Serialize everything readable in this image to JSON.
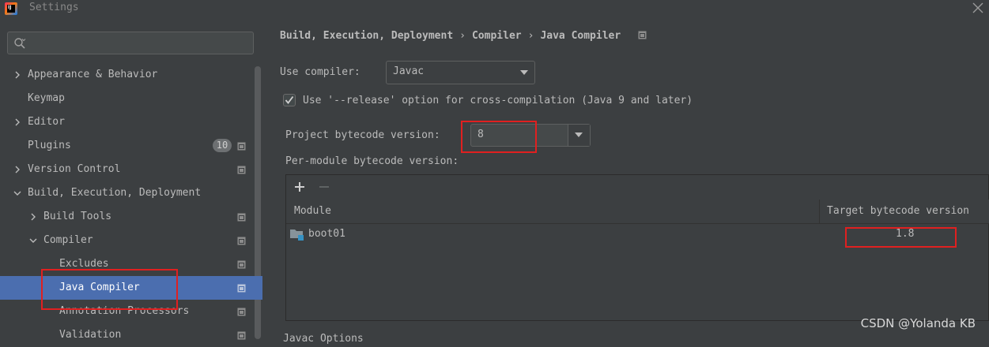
{
  "window": {
    "title": "Settings"
  },
  "search": {
    "placeholder": "",
    "value": ""
  },
  "sidebar": {
    "items": [
      {
        "label": "Appearance & Behavior"
      },
      {
        "label": "Keymap"
      },
      {
        "label": "Editor"
      },
      {
        "label": "Plugins",
        "badge": "10"
      },
      {
        "label": "Version Control"
      },
      {
        "label": "Build, Execution, Deployment"
      },
      {
        "label": "Build Tools"
      },
      {
        "label": "Compiler"
      },
      {
        "label": "Excludes"
      },
      {
        "label": "Java Compiler"
      },
      {
        "label": "Annotation Processors"
      },
      {
        "label": "Validation"
      }
    ]
  },
  "breadcrumb": {
    "parts": [
      "Build, Execution, Deployment",
      "Compiler",
      "Java Compiler"
    ],
    "separator": "›"
  },
  "compiler": {
    "use_compiler_label": "Use compiler:",
    "use_compiler_value": "Javac",
    "release_option_label": "Use '--release' option for cross-compilation (Java 9 and later)",
    "release_option_checked": true,
    "project_bytecode_label": "Project bytecode version:",
    "project_bytecode_value": "8",
    "per_module_label": "Per-module bytecode version:"
  },
  "toolbar": {
    "add_label": "+",
    "remove_label": "−"
  },
  "table": {
    "columns": [
      "Module",
      "Target bytecode version"
    ],
    "rows": [
      {
        "module": "boot01",
        "target": "1.8"
      }
    ]
  },
  "footer": {
    "cut_text": "Javac Options"
  },
  "watermark": "CSDN @Yolanda KB",
  "colors": {
    "background": "#3c3f41",
    "selection": "#4b6eaf",
    "highlight_box": "#e02020",
    "text": "#bbbbbb"
  }
}
